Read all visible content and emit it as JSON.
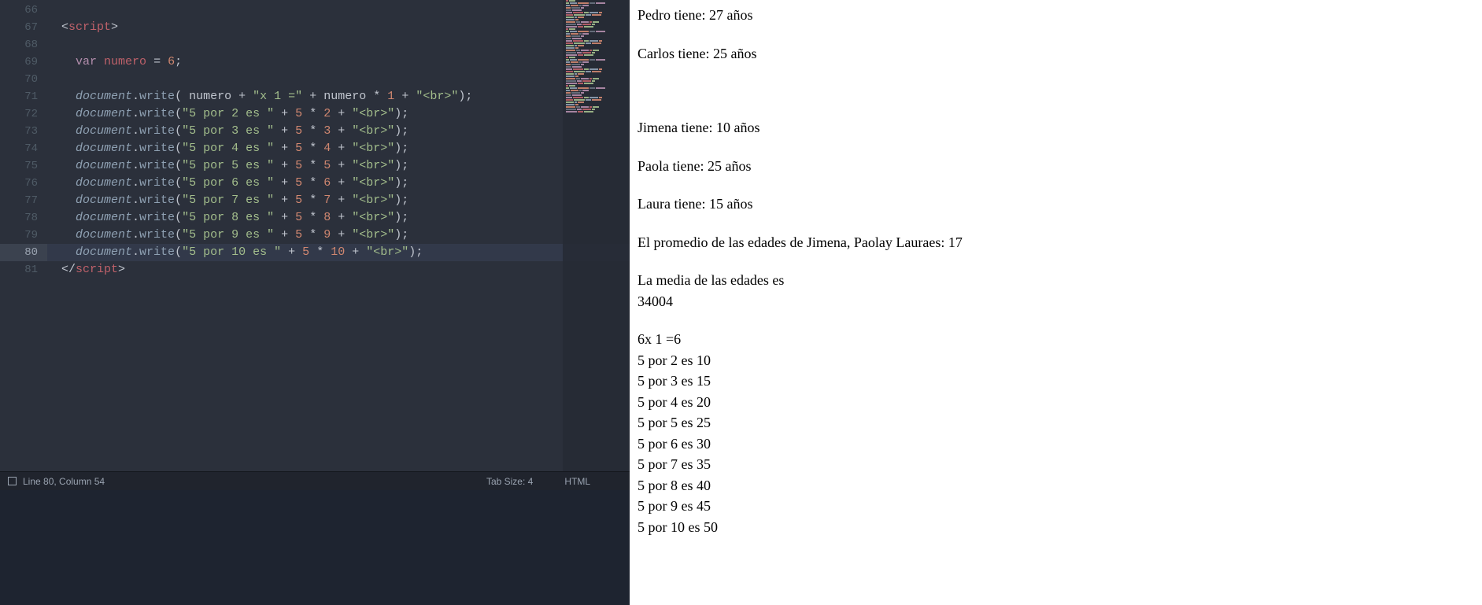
{
  "editor": {
    "first_line_number": 66,
    "active_line": 80,
    "lines": [
      "",
      {
        "type": "tag",
        "indent": 2,
        "open": true,
        "name": "script"
      },
      "",
      {
        "type": "vardecl",
        "indent": 4,
        "var": "numero",
        "val": "6"
      },
      "",
      {
        "type": "docwrite",
        "indent": 4,
        "variant": "first",
        "pre": "numero",
        "str1": "\"x 1 =\"",
        "a": "numero",
        "b": "1",
        "tail": "\"<br>\""
      },
      {
        "type": "docwrite",
        "indent": 4,
        "str1": "\"5 por 2 es \"",
        "a": "5",
        "b": "2",
        "tail": "\"<br>\""
      },
      {
        "type": "docwrite",
        "indent": 4,
        "str1": "\"5 por 3 es \"",
        "a": "5",
        "b": "3",
        "tail": "\"<br>\""
      },
      {
        "type": "docwrite",
        "indent": 4,
        "str1": "\"5 por 4 es \"",
        "a": "5",
        "b": "4",
        "tail": "\"<br>\""
      },
      {
        "type": "docwrite",
        "indent": 4,
        "str1": "\"5 por 5 es \"",
        "a": "5",
        "b": "5",
        "tail": "\"<br>\""
      },
      {
        "type": "docwrite",
        "indent": 4,
        "str1": "\"5 por 6 es \"",
        "a": "5",
        "b": "6",
        "tail": "\"<br>\""
      },
      {
        "type": "docwrite",
        "indent": 4,
        "str1": "\"5 por 7 es \"",
        "a": "5",
        "b": "7",
        "tail": "\"<br>\""
      },
      {
        "type": "docwrite",
        "indent": 4,
        "str1": "\"5 por 8 es \"",
        "a": "5",
        "b": "8",
        "tail": "\"<br>\""
      },
      {
        "type": "docwrite",
        "indent": 4,
        "str1": "\"5 por 9 es \"",
        "a": "5",
        "b": "9",
        "tail": "\"<br>\""
      },
      {
        "type": "docwrite",
        "indent": 4,
        "str1": "\"5 por 10 es \"",
        "a": "5",
        "b": "10",
        "tail": "\"<br>\""
      },
      {
        "type": "tag",
        "indent": 2,
        "open": false,
        "name": "script"
      }
    ]
  },
  "statusbar": {
    "position": "Line 80, Column 54",
    "tab_size": "Tab Size: 4",
    "syntax": "HTML"
  },
  "preview": {
    "items": [
      {
        "text": "Pedro tiene: 27 años",
        "gapAfter": "md"
      },
      {
        "text": "Carlos tiene: 25 años",
        "gapAfter": "lg"
      },
      {
        "text": "",
        "gapAfter": "md"
      },
      {
        "text": "Jimena tiene: 10 años",
        "gapAfter": "md"
      },
      {
        "text": "Paola tiene: 25 años",
        "gapAfter": "md"
      },
      {
        "text": "Laura tiene: 15 años",
        "gapAfter": "md"
      },
      {
        "text": "El promedio de las edades de Jimena, Paolay Lauraes: 17",
        "gapAfter": "md"
      },
      {
        "text": "La media de las edades es",
        "gapAfter": ""
      },
      {
        "text": "34004",
        "gapAfter": "md"
      },
      {
        "text": "6x 1 =6",
        "gapAfter": ""
      },
      {
        "text": "5 por 2 es 10",
        "gapAfter": ""
      },
      {
        "text": "5 por 3 es 15",
        "gapAfter": ""
      },
      {
        "text": "5 por 4 es 20",
        "gapAfter": ""
      },
      {
        "text": "5 por 5 es 25",
        "gapAfter": ""
      },
      {
        "text": "5 por 6 es 30",
        "gapAfter": ""
      },
      {
        "text": "5 por 7 es 35",
        "gapAfter": ""
      },
      {
        "text": "5 por 8 es 40",
        "gapAfter": ""
      },
      {
        "text": "5 por 9 es 45",
        "gapAfter": ""
      },
      {
        "text": "5 por 10 es 50",
        "gapAfter": ""
      }
    ]
  }
}
